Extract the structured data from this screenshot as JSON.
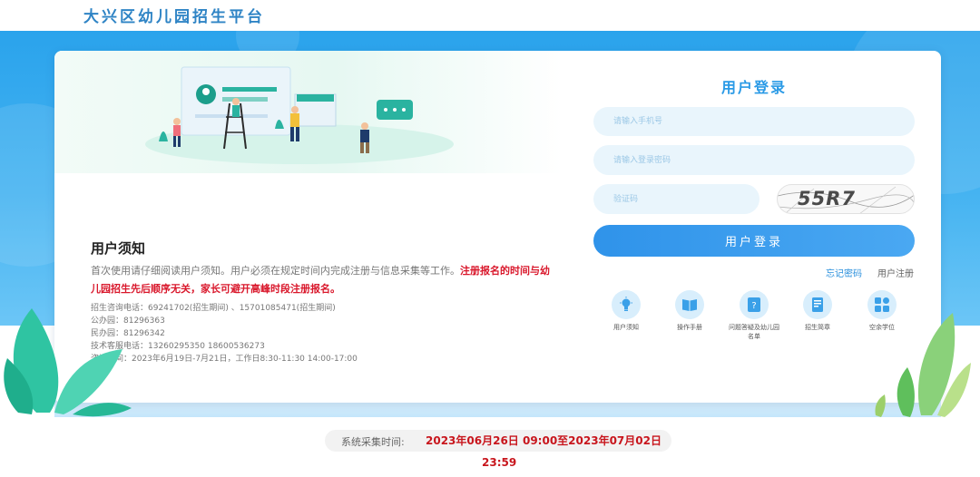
{
  "header": {
    "site_title": "大兴区幼儿园招生平台"
  },
  "notice": {
    "title": "用户须知",
    "text_normal": "首次使用请仔细阅读用户须知。用户必须在规定时间内完成注册与信息采集等工作。",
    "text_highlight": "注册报名的时间与幼儿园招生先后顺序无关，家长可避开高峰时段注册报名。",
    "contacts": [
      "招生咨询电话：69241702(招生期间) 、15701085471(招生期间)",
      "公办园：81296363",
      "民办园：81296342",
      "技术客服电话：13260295350  18600536273",
      "咨询时间：2023年6月19日-7月21日，工作日8:30-11:30  14:00-17:00"
    ]
  },
  "login": {
    "title": "用户登录",
    "phone_placeholder": "请输入手机号",
    "password_placeholder": "请输入登录密码",
    "captcha_placeholder": "验证码",
    "captcha_text": "55R7",
    "login_button": "用户登录",
    "forgot_password": "忘记密码",
    "register": "用户注册"
  },
  "quick_links": [
    {
      "label": "用户须知",
      "icon": "lightbulb-icon"
    },
    {
      "label": "操作手册",
      "icon": "open-book-icon"
    },
    {
      "label": "问题答疑及幼儿园名单",
      "icon": "question-document-icon"
    },
    {
      "label": "招生简章",
      "icon": "bookmark-book-icon"
    },
    {
      "label": "空余学位",
      "icon": "grid-apps-icon"
    }
  ],
  "period": {
    "label": "系统采集时间:",
    "value": "2023年06月26日 09:00至2023年07月02日",
    "end_time": "23:59"
  },
  "colors": {
    "accent": "#2a9ae6",
    "highlight_red": "#d9172b",
    "band_blue": "#2aa3ec"
  }
}
